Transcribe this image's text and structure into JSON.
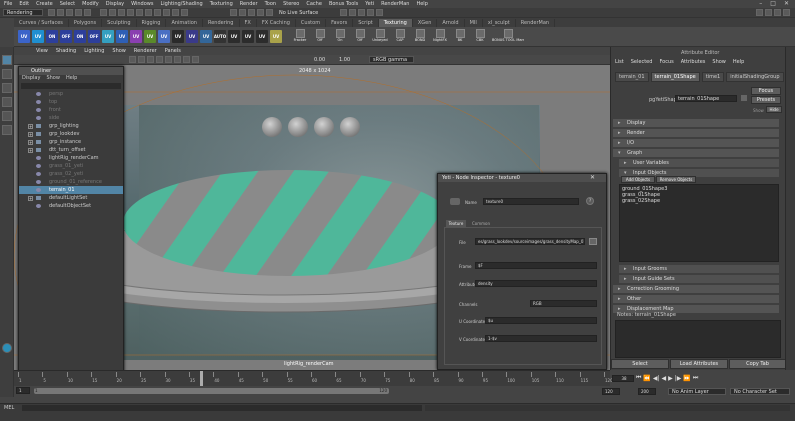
{
  "menubar": [
    "File",
    "Edit",
    "Create",
    "Select",
    "Modify",
    "Display",
    "Windows",
    "Lighting/Shading",
    "Texturing",
    "Render",
    "Toon",
    "Stereo",
    "Cache",
    "Bonus Tools",
    "Yeti",
    "RenderMan",
    "Help"
  ],
  "status": {
    "mode": "Rendering",
    "live_surface": "No Live Surface"
  },
  "shelf_tabs": [
    "Curves / Surfaces",
    "Polygons",
    "Sculpting",
    "Rigging",
    "Animation",
    "Rendering",
    "FX",
    "FX Caching",
    "Custom",
    "Favors",
    "Script",
    "Texturing",
    "XGen",
    "Arnold",
    "MII",
    "xl_sculpt",
    "RenderMan"
  ],
  "active_shelf_tab": "Texturing",
  "shelf_icons": [
    {
      "label": "UV",
      "color": "#3b64c9"
    },
    {
      "label": "UV",
      "color": "#1f8fd0"
    },
    {
      "label": "ON",
      "color": "#2d3f9b"
    },
    {
      "label": "OFF",
      "color": "#2d3f9b"
    },
    {
      "label": "ON",
      "color": "#2d3f9b"
    },
    {
      "label": "OFF",
      "color": "#2d3f9b"
    },
    {
      "label": "UV",
      "color": "#34a0c0"
    },
    {
      "label": "UV",
      "color": "#2e5fb5"
    },
    {
      "label": "UV",
      "color": "#8a3fb0"
    },
    {
      "label": "UV",
      "color": "#5a8a2a"
    },
    {
      "label": "UV",
      "color": "#4a6fc3"
    },
    {
      "label": "UV",
      "color": "#2a2a2a"
    },
    {
      "label": "UV",
      "color": "#3a3a8a"
    },
    {
      "label": "UV",
      "color": "#336699"
    },
    {
      "label": "AUTO",
      "color": "#333"
    },
    {
      "label": "UV",
      "color": "#2c2c2c"
    },
    {
      "label": "UV",
      "color": "#2c2c2c"
    },
    {
      "label": "UV",
      "color": "#2c2c2c"
    },
    {
      "label": "UV",
      "color": "#a9a24a"
    }
  ],
  "shelf_labels": [
    "Fracker",
    "Off",
    "On",
    "Off",
    "Unkeyed",
    "CAP",
    "BOND",
    "NightFX",
    "BK",
    "CBK",
    "BONUS TOOL MarnelUV+MM"
  ],
  "viewport": {
    "menu": [
      "View",
      "Shading",
      "Lighting",
      "Show",
      "Renderer",
      "Panels"
    ],
    "resolution": "2048 x 1024",
    "camera_label": "lightRig_renderCam",
    "gamma": "sRGB gamma",
    "exposure": "0.00",
    "gamma_val": "1.00"
  },
  "outliner": {
    "title": "Outliner",
    "menu": [
      "Display",
      "Show",
      "Help"
    ],
    "rows": [
      {
        "label": "persp",
        "dim": true,
        "exp": ""
      },
      {
        "label": "top",
        "dim": true,
        "exp": ""
      },
      {
        "label": "front",
        "dim": true,
        "exp": ""
      },
      {
        "label": "side",
        "dim": true,
        "exp": ""
      },
      {
        "label": "grp_lighting",
        "dim": false,
        "exp": "+"
      },
      {
        "label": "grp_lookdev",
        "dim": false,
        "exp": "+"
      },
      {
        "label": "grp_instance",
        "dim": false,
        "exp": "+"
      },
      {
        "label": "dtt_turn_offset",
        "dim": false,
        "exp": "+"
      },
      {
        "label": "lightRig_renderCam",
        "dim": false,
        "exp": ""
      },
      {
        "label": "grass_01_yeti",
        "dim": true,
        "exp": ""
      },
      {
        "label": "grass_02_yeti",
        "dim": true,
        "exp": ""
      },
      {
        "label": "ground_01_reference",
        "dim": true,
        "exp": ""
      },
      {
        "label": "terrain_01",
        "dim": false,
        "exp": "",
        "sel": true
      },
      {
        "label": "defaultLightSet",
        "dim": false,
        "exp": "+"
      },
      {
        "label": "defaultObjectSet",
        "dim": false,
        "exp": ""
      }
    ]
  },
  "inspector": {
    "title": "Yeti - Node Inspector - texture0",
    "name_label": "Name",
    "name_value": "texture0",
    "tabs": [
      "Texture",
      "Common"
    ],
    "file_label": "File",
    "file_value": "es/grass_lookdev/sourceimages/grass_densityMap_01.png",
    "frame_label": "Frame",
    "frame_value": "$F",
    "attribute_label": "Attribute",
    "attribute_value": "density",
    "channels_label": "Channels",
    "channels_value": "RGB",
    "u_label": "U Coordinate",
    "u_value": "$u",
    "v_label": "V Coordinate",
    "v_value": "1-$v"
  },
  "attribute_editor": {
    "header": "Attribute Editor",
    "menu": [
      "List",
      "Selected",
      "Focus",
      "Attributes",
      "Show",
      "Help"
    ],
    "tabs": [
      "terrain_01",
      "terrain_01Shape",
      "time1",
      "initialShadingGroup"
    ],
    "node_label": "pgYetiShape:",
    "node_value": "terrain_01Shape",
    "btn_focus": "Focus",
    "btn_presets": "Presets",
    "show_label": "Show",
    "btn_hide": "Hide",
    "sections": [
      {
        "label": "Display",
        "open": false,
        "sub": false
      },
      {
        "label": "Render",
        "open": false,
        "sub": false
      },
      {
        "label": "I/O",
        "open": false,
        "sub": false
      },
      {
        "label": "Graph",
        "open": true,
        "sub": false
      },
      {
        "label": "User Variables",
        "open": false,
        "sub": true
      },
      {
        "label": "Input Objects",
        "open": true,
        "sub": true
      }
    ],
    "add_objects": "Add Objects",
    "remove_objects": "Remove Objects",
    "objects": [
      "ground_01Shape3",
      "grass_01Shape",
      "grass_02Shape"
    ],
    "sections2": [
      {
        "label": "Input Grooms",
        "sub": true
      },
      {
        "label": "Input Guide Sets",
        "sub": true
      },
      {
        "label": "Correction Grooming",
        "sub": false
      },
      {
        "label": "Other",
        "sub": false
      },
      {
        "label": "Displacement Map",
        "sub": false
      }
    ],
    "notes": "Notes: terrain_01Shape",
    "bottom_buttons": [
      "Select",
      "Load Attributes",
      "Copy Tab"
    ]
  },
  "timeline": {
    "ticks": [
      "1",
      "5",
      "10",
      "15",
      "20",
      "25",
      "30",
      "35",
      "40",
      "45",
      "50",
      "55",
      "60",
      "65",
      "70",
      "75",
      "80",
      "85",
      "90",
      "95",
      "100",
      "105",
      "110",
      "115",
      "120"
    ],
    "current_frame": "38",
    "range_start": "1",
    "range_end": "120",
    "range_start2": "120",
    "range_end2": "200",
    "anim_layer": "No Anim Layer",
    "char_set": "No Character Set"
  },
  "cmdline": {
    "label": "MEL"
  }
}
